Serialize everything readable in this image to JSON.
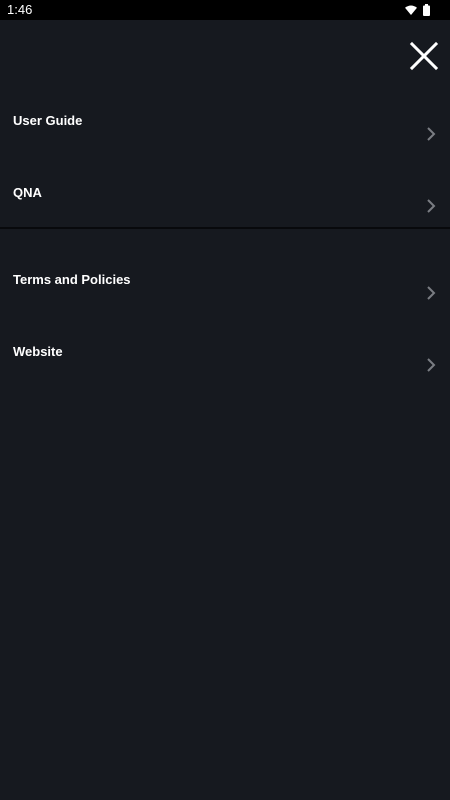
{
  "status_bar": {
    "time": "1:46",
    "icons": [
      "wifi-icon",
      "battery-icon"
    ]
  },
  "header": {
    "close_icon": "close-icon"
  },
  "menu": {
    "items": [
      {
        "label": "User Guide",
        "icon": "chevron-right-icon"
      },
      {
        "label": "QNA",
        "icon": "chevron-right-icon"
      },
      {
        "label": "Terms and Policies",
        "icon": "chevron-right-icon"
      },
      {
        "label": "Website",
        "icon": "chevron-right-icon"
      }
    ]
  },
  "colors": {
    "background": "#16191f",
    "status_bar": "#000000",
    "text": "#ffffff",
    "chevron": "#7a7d83",
    "divider": "#08090c"
  }
}
